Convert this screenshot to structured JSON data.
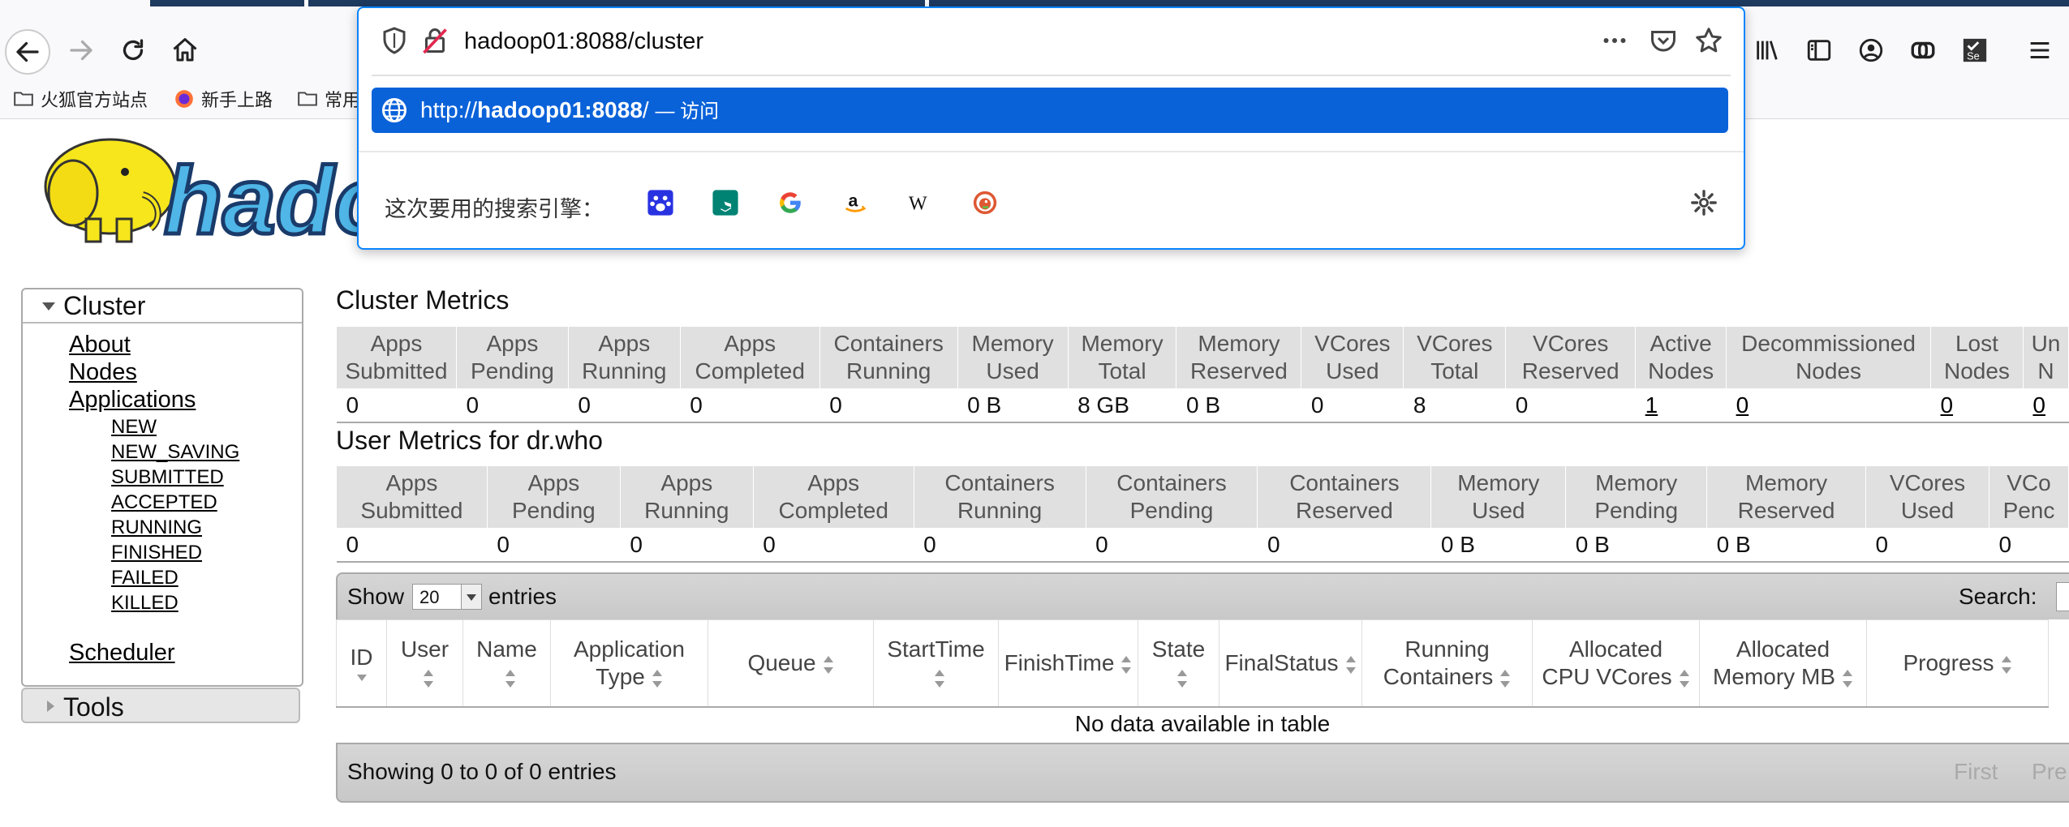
{
  "browser": {
    "url": "hadoop01:8088/cluster",
    "suggestion": {
      "scheme": "http://",
      "host": "hadoop01:8088",
      "path": "/",
      "action": "— 访问"
    },
    "search_engines_label": "这次要用的搜索引擎：",
    "search_engines": [
      "baidu-icon",
      "bing-icon",
      "google-icon",
      "amazon-icon",
      "wikipedia-icon",
      "duckduckgo-icon"
    ],
    "bookmarks": [
      "火狐官方站点",
      "新手上路",
      "常用"
    ],
    "accent": "#0a62d9"
  },
  "sidebar": {
    "cluster_title": "Cluster",
    "links": {
      "about": "About",
      "nodes": "Nodes",
      "applications": "Applications",
      "scheduler": "Scheduler"
    },
    "app_states": [
      "NEW",
      "NEW_SAVING",
      "SUBMITTED",
      "ACCEPTED",
      "RUNNING",
      "FINISHED",
      "FAILED",
      "KILLED"
    ],
    "tools_title": "Tools"
  },
  "cluster_metrics": {
    "title": "Cluster Metrics",
    "headers": [
      [
        "Apps",
        "Submitted"
      ],
      [
        "Apps",
        "Pending"
      ],
      [
        "Apps",
        "Running"
      ],
      [
        "Apps",
        "Completed"
      ],
      [
        "Containers",
        "Running"
      ],
      [
        "Memory",
        "Used"
      ],
      [
        "Memory",
        "Total"
      ],
      [
        "Memory",
        "Reserved"
      ],
      [
        "VCores",
        "Used"
      ],
      [
        "VCores",
        "Total"
      ],
      [
        "VCores",
        "Reserved"
      ],
      [
        "Active",
        "Nodes"
      ],
      [
        "Decommissioned",
        "Nodes"
      ],
      [
        "Lost",
        "Nodes"
      ],
      [
        "Un",
        "N"
      ]
    ],
    "values": [
      "0",
      "0",
      "0",
      "0",
      "0",
      "0 B",
      "8 GB",
      "0 B",
      "0",
      "8",
      "0",
      "1",
      "0",
      "0",
      "0"
    ]
  },
  "user_metrics": {
    "title": "User Metrics for dr.who",
    "headers": [
      [
        "Apps",
        "Submitted"
      ],
      [
        "Apps",
        "Pending"
      ],
      [
        "Apps",
        "Running"
      ],
      [
        "Apps",
        "Completed"
      ],
      [
        "Containers",
        "Running"
      ],
      [
        "Containers",
        "Pending"
      ],
      [
        "Containers",
        "Reserved"
      ],
      [
        "Memory",
        "Used"
      ],
      [
        "Memory",
        "Pending"
      ],
      [
        "Memory",
        "Reserved"
      ],
      [
        "VCores",
        "Used"
      ],
      [
        "VCo",
        "Penc"
      ]
    ],
    "values": [
      "0",
      "0",
      "0",
      "0",
      "0",
      "0",
      "0",
      "0 B",
      "0 B",
      "0 B",
      "0",
      "0"
    ]
  },
  "apps_table": {
    "show_label": "Show",
    "page_size": "20",
    "entries_label": "entries",
    "search_label": "Search:",
    "columns": [
      [
        "ID"
      ],
      [
        "User"
      ],
      [
        "Name"
      ],
      [
        "Application",
        "Type"
      ],
      [
        "Queue"
      ],
      [
        "StartTime"
      ],
      [
        "FinishTime"
      ],
      [
        "State"
      ],
      [
        "FinalStatus"
      ],
      [
        "Running",
        "Containers"
      ],
      [
        "Allocated",
        "CPU VCores"
      ],
      [
        "Allocated",
        "Memory MB"
      ],
      [
        "Progress"
      ]
    ],
    "empty_message": "No data available in table",
    "showing": "Showing 0 to 0 of 0 entries",
    "first": "First",
    "previous": "Pre"
  }
}
